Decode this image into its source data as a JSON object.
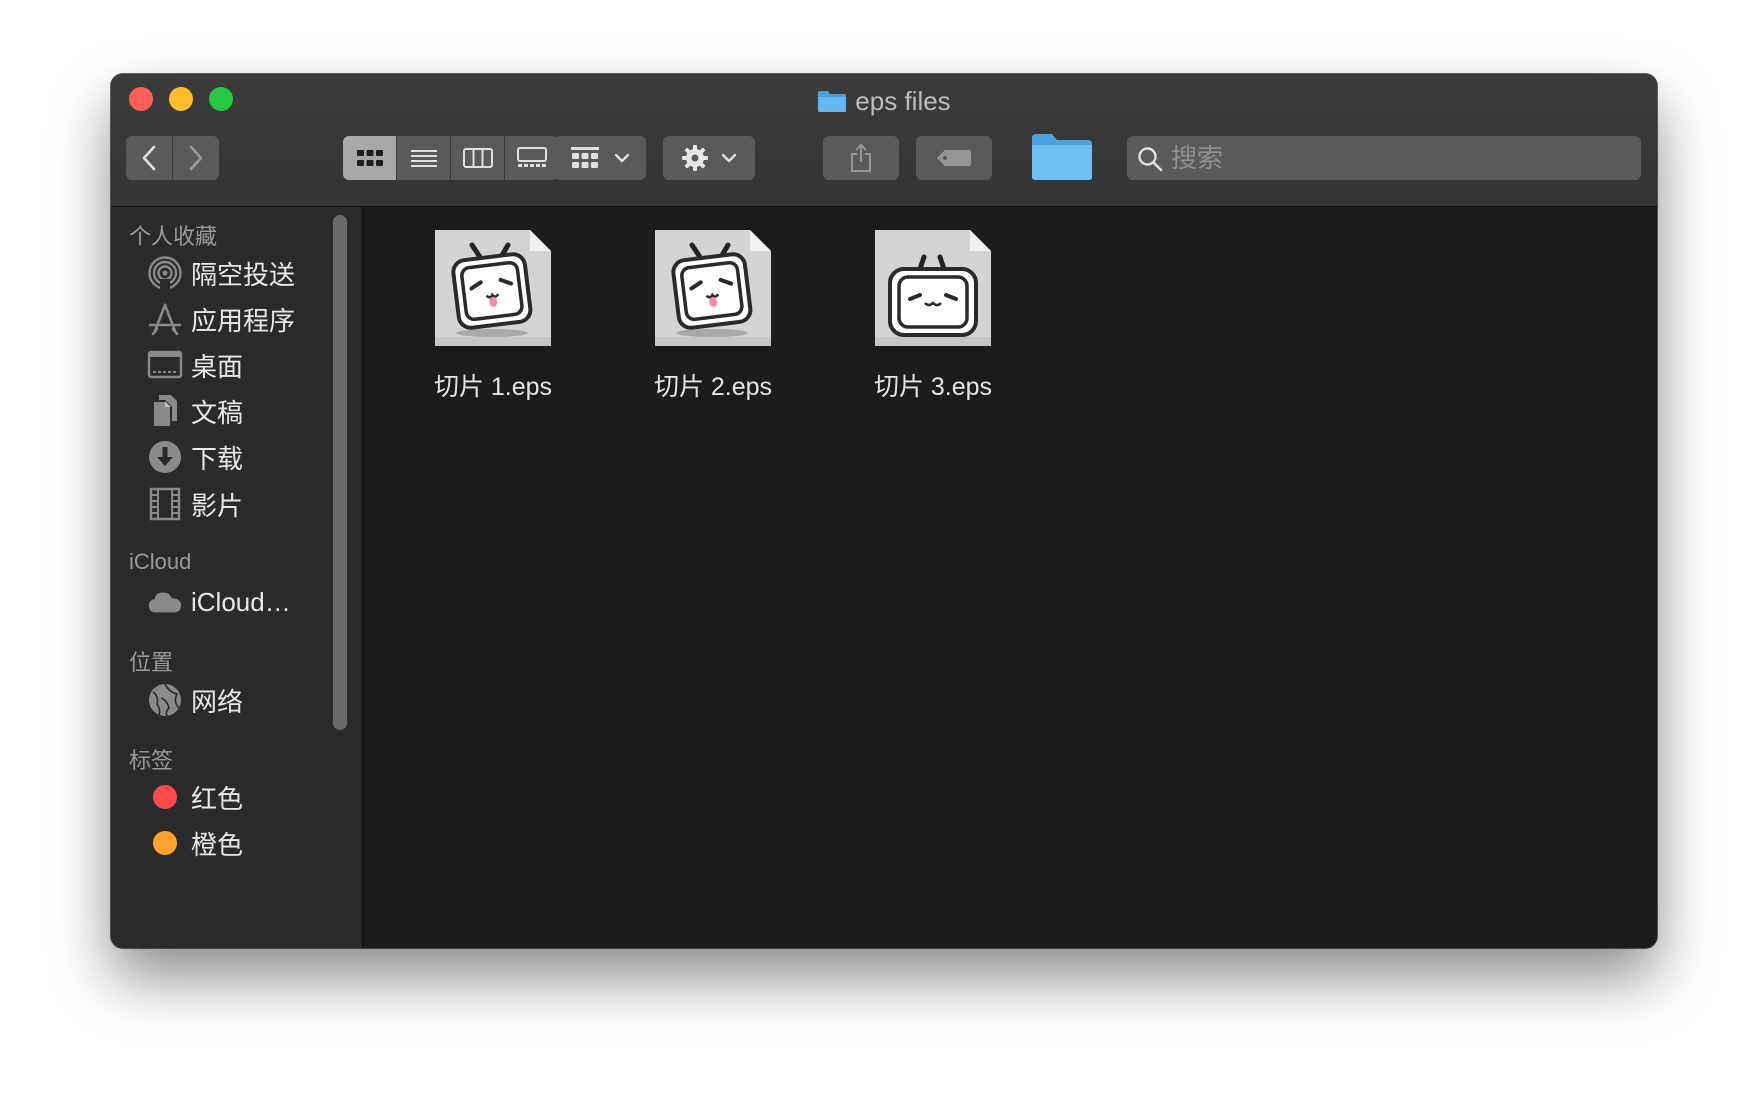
{
  "window": {
    "title": "eps files"
  },
  "toolbar": {
    "back_icon": "chevron-left-icon",
    "forward_icon": "chevron-right-icon",
    "view_modes": [
      "icon-view",
      "list-view",
      "column-view",
      "gallery-view"
    ],
    "active_view": "icon-view",
    "group_icon": "grid-group-icon",
    "action_icon": "gear-icon",
    "share_icon": "share-icon",
    "tag_icon": "tag-icon",
    "folder_color": "#5ab4f0"
  },
  "search": {
    "placeholder": "搜索",
    "value": ""
  },
  "sidebar": {
    "favorites": {
      "title": "个人收藏",
      "items": [
        {
          "label": "隔空投送",
          "icon": "airdrop-icon"
        },
        {
          "label": "应用程序",
          "icon": "applications-icon"
        },
        {
          "label": "桌面",
          "icon": "desktop-icon"
        },
        {
          "label": "文稿",
          "icon": "documents-icon"
        },
        {
          "label": "下载",
          "icon": "downloads-icon"
        },
        {
          "label": "影片",
          "icon": "movies-icon"
        }
      ]
    },
    "icloud": {
      "title": "iCloud",
      "items": [
        {
          "label": "iCloud…",
          "icon": "cloud-icon"
        }
      ]
    },
    "locations": {
      "title": "位置",
      "items": [
        {
          "label": "网络",
          "icon": "network-globe-icon"
        }
      ]
    },
    "tags": {
      "title": "标签",
      "items": [
        {
          "label": "红色",
          "color": "#ff4b4b"
        },
        {
          "label": "橙色",
          "color": "#ffa52c"
        }
      ]
    }
  },
  "files": [
    {
      "name": "切片 1.eps",
      "icon": "eps-file-tv-face-icon"
    },
    {
      "name": "切片 2.eps",
      "icon": "eps-file-tv-face-icon"
    },
    {
      "name": "切片 3.eps",
      "icon": "eps-file-tv-smile-icon"
    }
  ]
}
